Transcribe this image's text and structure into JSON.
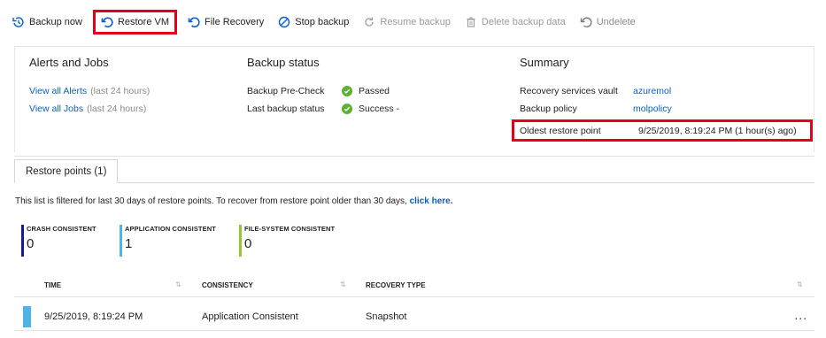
{
  "toolbar": {
    "backup_now": "Backup now",
    "restore_vm": "Restore VM",
    "file_recovery": "File Recovery",
    "stop_backup": "Stop backup",
    "resume_backup": "Resume backup",
    "delete_backup_data": "Delete backup data",
    "undelete": "Undelete"
  },
  "alerts_jobs": {
    "title": "Alerts and Jobs",
    "view_alerts": "View all Alerts",
    "view_alerts_suffix": "(last 24 hours)",
    "view_jobs": "View all Jobs",
    "view_jobs_suffix": "(last 24 hours)"
  },
  "backup_status": {
    "title": "Backup status",
    "precheck_label": "Backup Pre-Check",
    "precheck_value": "Passed",
    "last_label": "Last backup status",
    "last_value": "Success -"
  },
  "summary": {
    "title": "Summary",
    "vault_label": "Recovery services vault",
    "vault_value": "azuremol",
    "policy_label": "Backup policy",
    "policy_value": "molpolicy",
    "oldest_label": "Oldest restore point",
    "oldest_value": "9/25/2019, 8:19:24 PM (1 hour(s) ago)"
  },
  "restore_points": {
    "tab_label": "Restore points (1)",
    "filter_text": "This list is filtered for last 30 days of restore points. To recover from restore point older than 30 days,",
    "filter_link": "click here.",
    "stats": [
      {
        "label": "CRASH CONSISTENT",
        "value": "0",
        "color": "#1a1a8c"
      },
      {
        "label": "APPLICATION CONSISTENT",
        "value": "1",
        "color": "#4fb3e5"
      },
      {
        "label": "FILE-SYSTEM CONSISTENT",
        "value": "0",
        "color": "#9cc33b"
      }
    ],
    "columns": [
      "TIME",
      "CONSISTENCY",
      "RECOVERY TYPE"
    ],
    "rows": [
      {
        "time": "9/25/2019, 8:19:24 PM",
        "consistency": "Application Consistent",
        "recovery_type": "Snapshot"
      }
    ],
    "row_menu": "..."
  },
  "colors": {
    "accent": "#0a5fc2",
    "highlight": "#e2001a",
    "success": "#5cb130"
  }
}
